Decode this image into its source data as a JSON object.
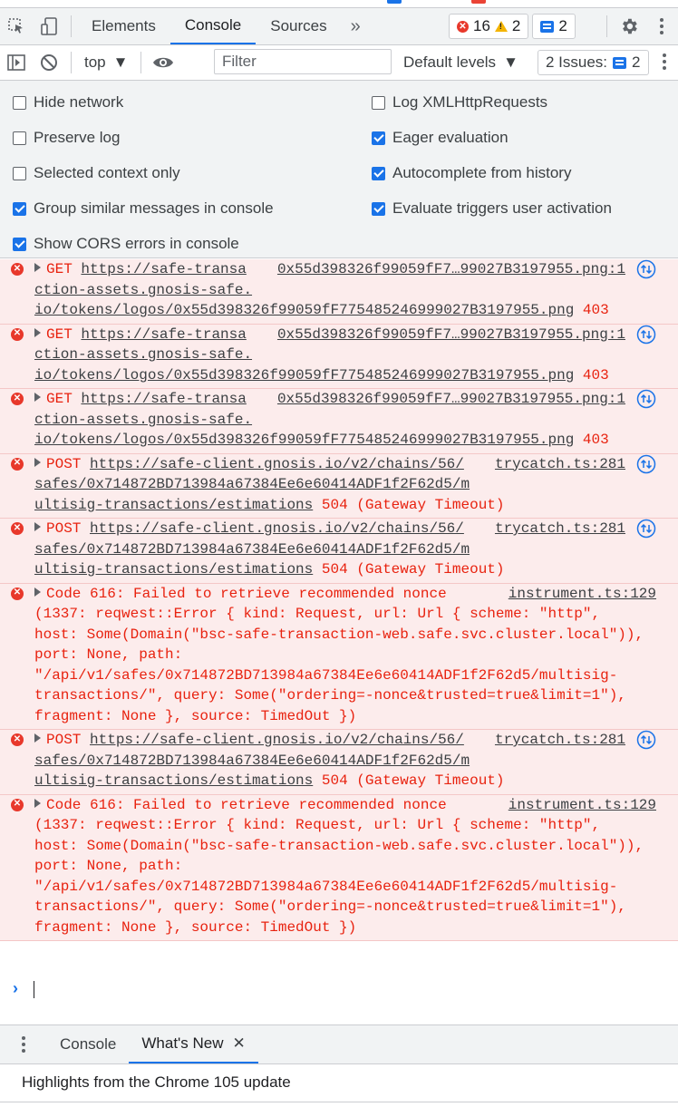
{
  "tabs": {
    "elements": "Elements",
    "console": "Console",
    "sources": "Sources",
    "more": "»"
  },
  "counts": {
    "errors": "16",
    "warnings": "2",
    "messages": "2"
  },
  "toolbar": {
    "context": "top",
    "filter_placeholder": "Filter",
    "levels": "Default levels",
    "issues_label": "2 Issues:",
    "issues_count": "2"
  },
  "settings": {
    "hide_network": {
      "label": "Hide network",
      "checked": false
    },
    "log_xhr": {
      "label": "Log XMLHttpRequests",
      "checked": false
    },
    "preserve_log": {
      "label": "Preserve log",
      "checked": false
    },
    "eager_eval": {
      "label": "Eager evaluation",
      "checked": true
    },
    "selected_context": {
      "label": "Selected context only",
      "checked": false
    },
    "autocomplete": {
      "label": "Autocomplete from history",
      "checked": true
    },
    "group_similar": {
      "label": "Group similar messages in console",
      "checked": true
    },
    "eval_triggers": {
      "label": "Evaluate triggers user activation",
      "checked": true
    },
    "show_cors": {
      "label": "Show CORS errors in console",
      "checked": true
    }
  },
  "messages": [
    {
      "method": "GET",
      "url1": "https://safe-transa",
      "src": "0x55d398326f99059fF7…99027B3197955.png:1",
      "l2": "ction-assets.gnosis-safe.",
      "l3": "io/tokens/logos/0x55d398326f99059fF775485246999027B3197955.png",
      "status": "403"
    },
    {
      "method": "GET",
      "url1": "https://safe-transa",
      "src": "0x55d398326f99059fF7…99027B3197955.png:1",
      "l2": "ction-assets.gnosis-safe.",
      "l3": "io/tokens/logos/0x55d398326f99059fF775485246999027B3197955.png",
      "status": "403"
    },
    {
      "method": "GET",
      "url1": "https://safe-transa",
      "src": "0x55d398326f99059fF7…99027B3197955.png:1",
      "l2": "ction-assets.gnosis-safe.",
      "l3": "io/tokens/logos/0x55d398326f99059fF775485246999027B3197955.png",
      "status": "403"
    },
    {
      "method": "POST",
      "url1": "https://safe-client.gnosis.io/v2/chains/56/",
      "src": "trycatch.ts:281",
      "l2": "safes/0x714872BD713984a67384Ee6e60414ADF1f2F62d5/m",
      "l3": "ultisig-transactions/estimations",
      "status": "504 (Gateway Timeout)"
    },
    {
      "method": "POST",
      "url1": "https://safe-client.gnosis.io/v2/chains/56/",
      "src": "trycatch.ts:281",
      "l2": "safes/0x714872BD713984a67384Ee6e60414ADF1f2F62d5/m",
      "l3": "ultisig-transactions/estimations",
      "status": "504 (Gateway Timeout)"
    },
    {
      "code": "Code 616: Failed to retrieve recommended nonce",
      "src": "instrument.ts:129",
      "lines": [
        "(1337: reqwest::Error { kind: Request, url: Url { scheme: \"http\",",
        "host: Some(Domain(\"bsc-safe-transaction-web.safe.svc.cluster.local\")),",
        "port: None, path:",
        "\"/api/v1/safes/0x714872BD713984a67384Ee6e60414ADF1f2F62d5/multisig-",
        "transactions/\", query: Some(\"ordering=-nonce&trusted=true&limit=1\"),",
        "fragment: None }, source: TimedOut })"
      ]
    },
    {
      "method": "POST",
      "url1": "https://safe-client.gnosis.io/v2/chains/56/",
      "src": "trycatch.ts:281",
      "l2": "safes/0x714872BD713984a67384Ee6e60414ADF1f2F62d5/m",
      "l3": "ultisig-transactions/estimations",
      "status": "504 (Gateway Timeout)"
    },
    {
      "code": "Code 616: Failed to retrieve recommended nonce",
      "src": "instrument.ts:129",
      "lines": [
        "(1337: reqwest::Error { kind: Request, url: Url { scheme: \"http\",",
        "host: Some(Domain(\"bsc-safe-transaction-web.safe.svc.cluster.local\")),",
        "port: None, path:",
        "\"/api/v1/safes/0x714872BD713984a67384Ee6e60414ADF1f2F62d5/multisig-",
        "transactions/\", query: Some(\"ordering=-nonce&trusted=true&limit=1\"),",
        "fragment: None }, source: TimedOut })"
      ]
    }
  ],
  "drawer": {
    "console": "Console",
    "whats_new": "What's New",
    "close": "✕",
    "highlights": "Highlights from the Chrome 105 update"
  },
  "icons": {
    "error": "error-circle-icon",
    "network": "network-request-icon"
  }
}
